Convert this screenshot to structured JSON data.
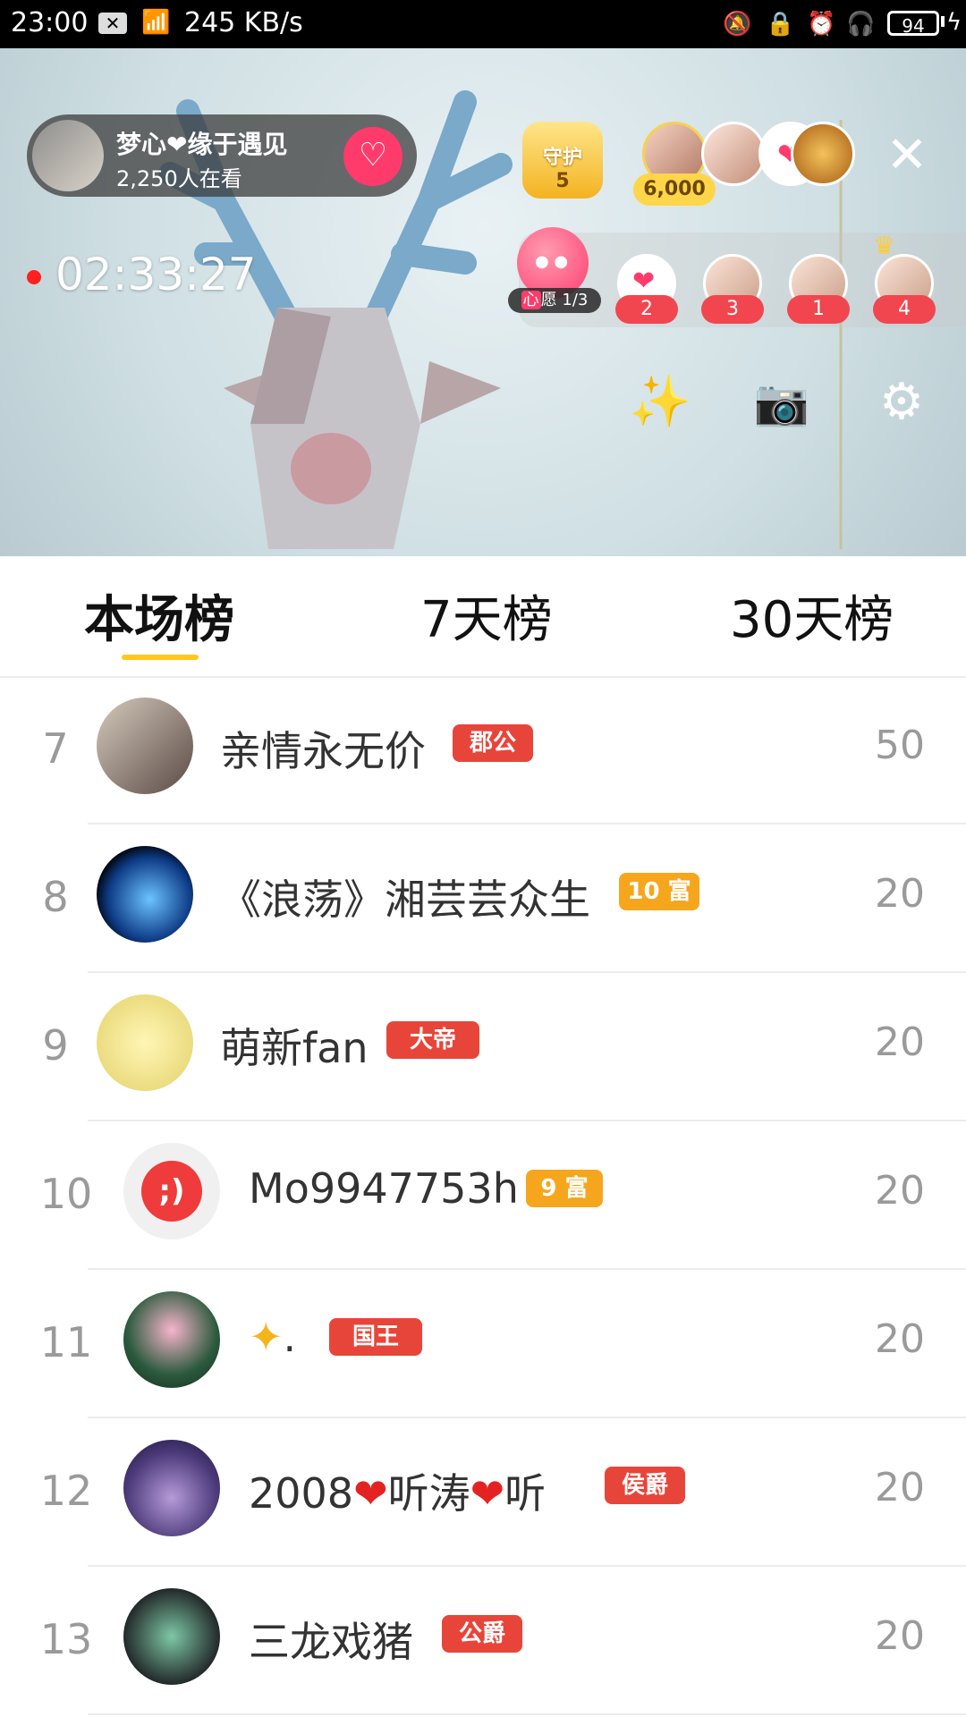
{
  "status_bar": {
    "time": "23:00",
    "net_speed": "245 KB/s",
    "battery": "94"
  },
  "live": {
    "host_name": "梦心❤缘于遇见",
    "viewers": "2,250人在看",
    "guard_label": "守护",
    "guard_count": "5",
    "fan_coins": "6,000",
    "timer": "02:33:27",
    "wish_label_first": "心",
    "wish_label_rest": "愿 1/3",
    "wish_counts": [
      "2",
      "3",
      "1",
      "4"
    ]
  },
  "tabs": [
    "本场榜",
    "7天榜",
    "30天榜"
  ],
  "ranking": [
    {
      "rank": "7",
      "name": "亲情永无价",
      "badge": "郡公",
      "score": "50"
    },
    {
      "rank": "8",
      "name": "《浪荡》湘芸芸众生",
      "badge": "10 富",
      "score": "20"
    },
    {
      "rank": "9",
      "name": "萌新fan",
      "badge": "大帝",
      "score": "20"
    },
    {
      "rank": "10",
      "name": "Mo9947753h",
      "badge": "9 富",
      "score": "20"
    },
    {
      "rank": "11",
      "name": ".",
      "badge": "国王",
      "score": "20"
    },
    {
      "rank": "12",
      "name_parts": [
        "2008",
        "❤",
        "听涛",
        "❤",
        "听"
      ],
      "badge": "侯爵",
      "score": "20"
    },
    {
      "rank": "13",
      "name": "三龙戏猪",
      "badge": "公爵",
      "score": "20"
    }
  ],
  "colors": {
    "tab_underline": "#ffc81e",
    "badge_red": "#e8453a",
    "badge_gold": "#f6a61d",
    "follow_button": "#ff3b6b"
  },
  "icons": {
    "close": "close-icon",
    "magic": "magic-wand-icon",
    "camera": "camera-switch-icon",
    "settings": "settings-gear-icon"
  }
}
